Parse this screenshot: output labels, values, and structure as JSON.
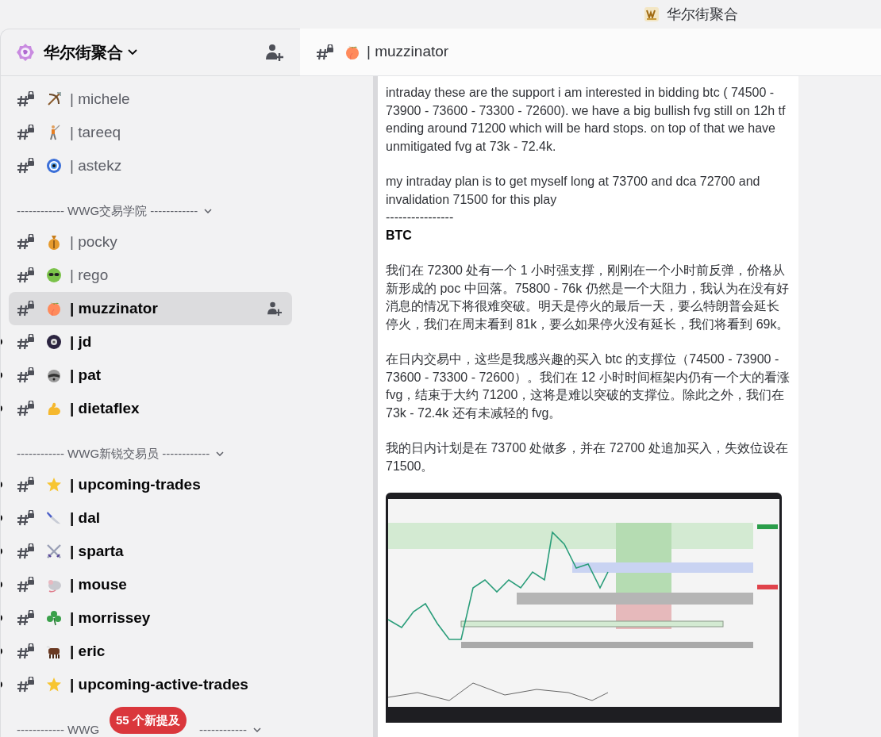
{
  "topbar": {
    "title": "华尔街聚合"
  },
  "server": {
    "name": "华尔街聚合"
  },
  "sidebar": {
    "items": [
      {
        "kind": "channel",
        "name": "| michele",
        "unread": false,
        "selected": false
      },
      {
        "kind": "channel",
        "name": "| tareeq",
        "unread": false,
        "selected": false
      },
      {
        "kind": "channel",
        "name": "| astekz",
        "unread": false,
        "selected": false
      },
      {
        "kind": "category",
        "label": "------------ WWG交易学院 ------------"
      },
      {
        "kind": "channel",
        "name": "| pocky",
        "unread": false,
        "selected": false
      },
      {
        "kind": "channel",
        "name": "| rego",
        "unread": false,
        "selected": false
      },
      {
        "kind": "channel",
        "name": "| muzzinator",
        "unread": false,
        "selected": true
      },
      {
        "kind": "channel",
        "name": "| jd",
        "unread": true,
        "selected": false
      },
      {
        "kind": "channel",
        "name": "| pat",
        "unread": true,
        "selected": false
      },
      {
        "kind": "channel",
        "name": "| dietaflex",
        "unread": true,
        "selected": false
      },
      {
        "kind": "category",
        "label": "------------ WWG新锐交易员 ------------"
      },
      {
        "kind": "channel",
        "name": "| upcoming-trades",
        "unread": true,
        "selected": false
      },
      {
        "kind": "channel",
        "name": "| dal",
        "unread": true,
        "selected": false
      },
      {
        "kind": "channel",
        "name": "| sparta",
        "unread": true,
        "selected": false
      },
      {
        "kind": "channel",
        "name": "| mouse",
        "unread": true,
        "selected": false
      },
      {
        "kind": "channel",
        "name": "| morrissey",
        "unread": true,
        "selected": false
      },
      {
        "kind": "channel",
        "name": "| eric",
        "unread": true,
        "selected": false
      },
      {
        "kind": "channel",
        "name": "| upcoming-active-trades",
        "unread": true,
        "selected": false
      },
      {
        "kind": "category",
        "label": "------------ WWG",
        "label_end": "------------"
      }
    ]
  },
  "mentions_badge": "55 个新提及",
  "channel_header": {
    "name": "| muzzinator"
  },
  "message": {
    "blocks": [
      [
        {
          "kind": "text",
          "text": "intraday these are the support i am interested in bidding btc ( 74500 - 73900 - 73600 - 73300 - 72600). we have a big bullish fvg still on 12h tf ending around 71200 which will be hard stops. on top of that we have unmitigated fvg at 73k - 72.4k."
        }
      ],
      [
        {
          "kind": "text",
          "text": "my intraday plan is to get myself long at 73700 and dca 72700 and invalidation 71500 for this play"
        },
        {
          "kind": "rule",
          "text": "----------------"
        },
        {
          "kind": "heading",
          "text": "BTC"
        }
      ],
      [
        {
          "kind": "text",
          "text": "我们在 72300 处有一个 1 小时强支撑，刚刚在一个小时前反弹，价格从新形成的 poc 中回落。75800 - 76k 仍然是一个大阻力，我认为在没有好消息的情况下将很难突破。明天是停火的最后一天，要么特朗普会延长停火，我们在周末看到 81k，要么如果停火没有延长，我们将看到 69k。"
        }
      ],
      [
        {
          "kind": "text",
          "text": "在日内交易中，这些是我感兴趣的买入 btc 的支撑位（74500 - 73900 - 73600 - 73300 - 72600）。我们在 12 小时时间框架内仍有一个大的看涨 fvg，结束于大约 71200，这将是难以突破的支撑位。除此之外，我们在 73k - 72.4k 还有未减轻的 fvg。"
        }
      ],
      [
        {
          "kind": "text",
          "text": "我的日内计划是在 73700 处做多，并在 72700 处追加买入，失效位设在 71500。"
        }
      ]
    ]
  }
}
